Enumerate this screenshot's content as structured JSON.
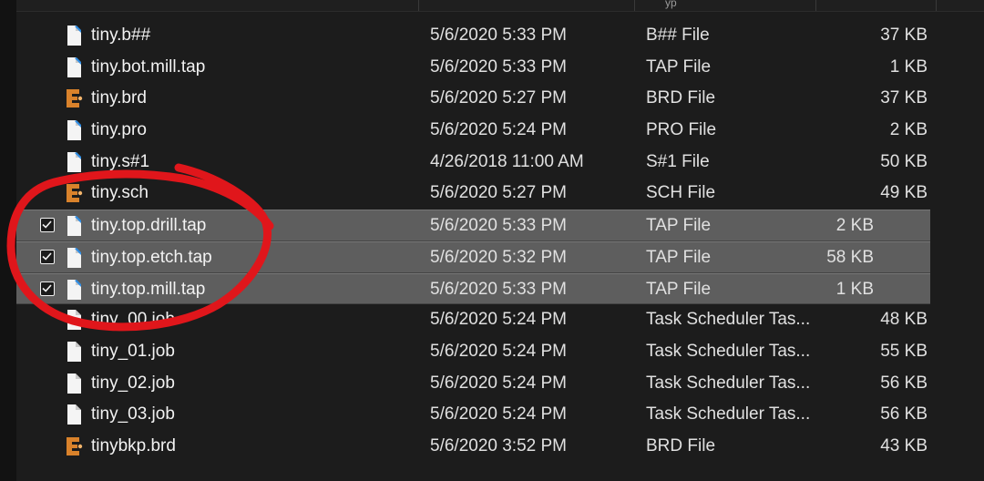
{
  "header": {
    "type_col_partial": "yp"
  },
  "files": [
    {
      "name": "tiny.b##",
      "date": "5/6/2020 5:33 PM",
      "type": "B## File",
      "size": "37 KB",
      "icon": "document-icon",
      "selected": false
    },
    {
      "name": "tiny.bot.mill.tap",
      "date": "5/6/2020 5:33 PM",
      "type": "TAP File",
      "size": "1 KB",
      "icon": "document-icon",
      "selected": false
    },
    {
      "name": "tiny.brd",
      "date": "5/6/2020 5:27 PM",
      "type": "BRD File",
      "size": "37 KB",
      "icon": "eagle-board-icon",
      "selected": false
    },
    {
      "name": "tiny.pro",
      "date": "5/6/2020 5:24 PM",
      "type": "PRO File",
      "size": "2 KB",
      "icon": "document-icon",
      "selected": false
    },
    {
      "name": "tiny.s#1",
      "date": "4/26/2018 11:00 AM",
      "type": "S#1 File",
      "size": "50 KB",
      "icon": "document-icon",
      "selected": false
    },
    {
      "name": "tiny.sch",
      "date": "5/6/2020 5:27 PM",
      "type": "SCH File",
      "size": "49 KB",
      "icon": "eagle-schematic-icon",
      "selected": false
    },
    {
      "name": "tiny.top.drill.tap",
      "date": "5/6/2020 5:33 PM",
      "type": "TAP File",
      "size": "2 KB",
      "icon": "document-icon",
      "selected": true
    },
    {
      "name": "tiny.top.etch.tap",
      "date": "5/6/2020 5:32 PM",
      "type": "TAP File",
      "size": "58 KB",
      "icon": "document-icon",
      "selected": true
    },
    {
      "name": "tiny.top.mill.tap",
      "date": "5/6/2020 5:33 PM",
      "type": "TAP File",
      "size": "1 KB",
      "icon": "document-icon",
      "selected": true
    },
    {
      "name": "tiny_00.job",
      "date": "5/6/2020 5:24 PM",
      "type": "Task Scheduler Tas...",
      "size": "48 KB",
      "icon": "blank-document-icon",
      "selected": false
    },
    {
      "name": "tiny_01.job",
      "date": "5/6/2020 5:24 PM",
      "type": "Task Scheduler Tas...",
      "size": "55 KB",
      "icon": "blank-document-icon",
      "selected": false
    },
    {
      "name": "tiny_02.job",
      "date": "5/6/2020 5:24 PM",
      "type": "Task Scheduler Tas...",
      "size": "56 KB",
      "icon": "blank-document-icon",
      "selected": false
    },
    {
      "name": "tiny_03.job",
      "date": "5/6/2020 5:24 PM",
      "type": "Task Scheduler Tas...",
      "size": "56 KB",
      "icon": "blank-document-icon",
      "selected": false
    },
    {
      "name": "tinybkp.brd",
      "date": "5/6/2020 3:52 PM",
      "type": "BRD File",
      "size": "43 KB",
      "icon": "eagle-board-icon",
      "selected": false
    }
  ],
  "colors": {
    "background": "#1c1c1c",
    "selected_row": "#5e5e5e",
    "text": "#f2f2f2",
    "annotation": "#e0161b",
    "eagle_icon": "#d9822b"
  }
}
